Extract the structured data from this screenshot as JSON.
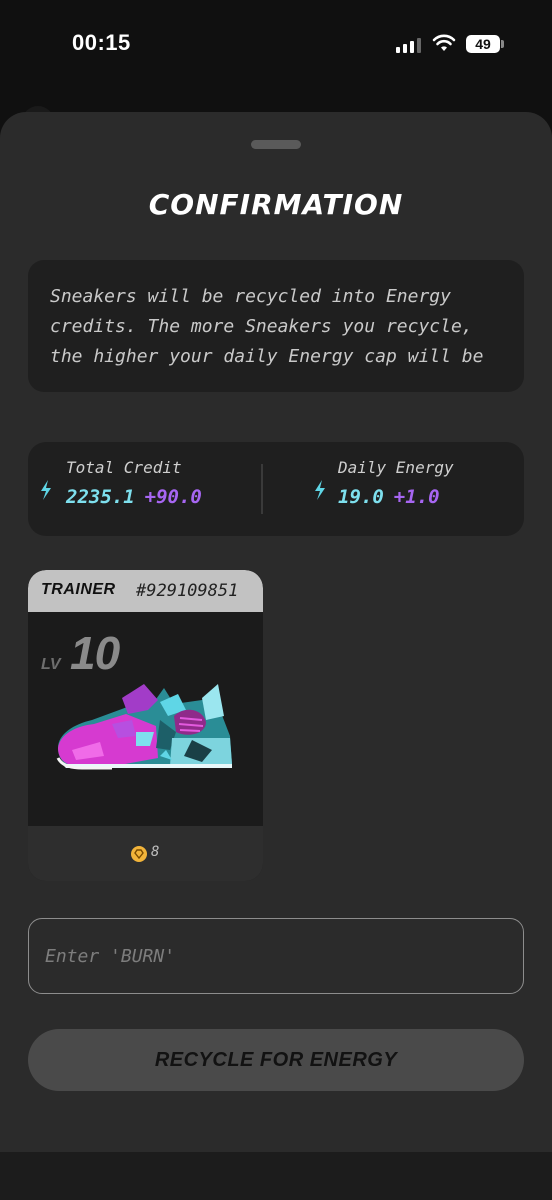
{
  "status_bar": {
    "time": "00:15",
    "battery": "49"
  },
  "sheet": {
    "title": "CONFIRMATION",
    "info_text": "Sneakers will be recycled into Energy credits. The more Sneakers you recycle, the higher your daily Energy cap will be",
    "stats": {
      "total_credit": {
        "label": "Total Credit",
        "value": "2235.1",
        "change": "+90.0"
      },
      "daily_energy": {
        "label": "Daily Energy",
        "value": "19.0",
        "change": "+1.0"
      }
    },
    "sneaker_card": {
      "type": "TRAINER",
      "id": "#929109851",
      "level_label": "LV",
      "level": "10",
      "gem_count": "8"
    },
    "burn_input": {
      "placeholder": "Enter 'BURN'",
      "value": ""
    },
    "recycle_button": "RECYCLE FOR ENERGY"
  },
  "colors": {
    "value_cyan": "#7ee0ee",
    "change_purple": "#a766f2",
    "coin_gold": "#f2b43a"
  }
}
